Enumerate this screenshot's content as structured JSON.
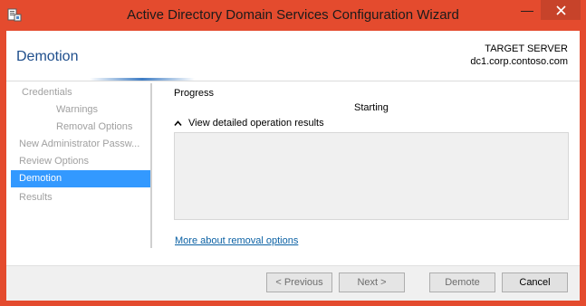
{
  "window": {
    "title": "Active Directory Domain Services Configuration Wizard",
    "minimize_glyph": "—",
    "icons": {
      "app": "ad-wizard-icon",
      "close": "close-icon"
    },
    "colors": {
      "frame": "#e44b2e",
      "close_button": "#c7432a",
      "accent": "#3399ff",
      "link": "#0b61a4",
      "heading": "#1e4e8c"
    }
  },
  "header": {
    "page_title": "Demotion",
    "target_label": "TARGET SERVER",
    "target_name": "dc1.corp.contoso.com"
  },
  "nav": {
    "items": [
      {
        "label": "Credentials",
        "state": "disabled"
      },
      {
        "label": "Warnings",
        "state": "disabled"
      },
      {
        "label": "Removal Options",
        "state": "disabled"
      },
      {
        "label": "New Administrator Passw...",
        "state": "disabled"
      },
      {
        "label": "Review Options",
        "state": "disabled"
      },
      {
        "label": "Demotion",
        "state": "selected"
      },
      {
        "label": "Results",
        "state": "disabled"
      }
    ]
  },
  "content": {
    "progress_label": "Progress",
    "status": "Starting",
    "details_toggle": "View detailed operation results",
    "details_toggle_icon": "chevron-up-icon",
    "more_link": "More about removal options"
  },
  "footer": {
    "previous": "< Previous",
    "next": "Next >",
    "demote": "Demote",
    "cancel": "Cancel"
  }
}
